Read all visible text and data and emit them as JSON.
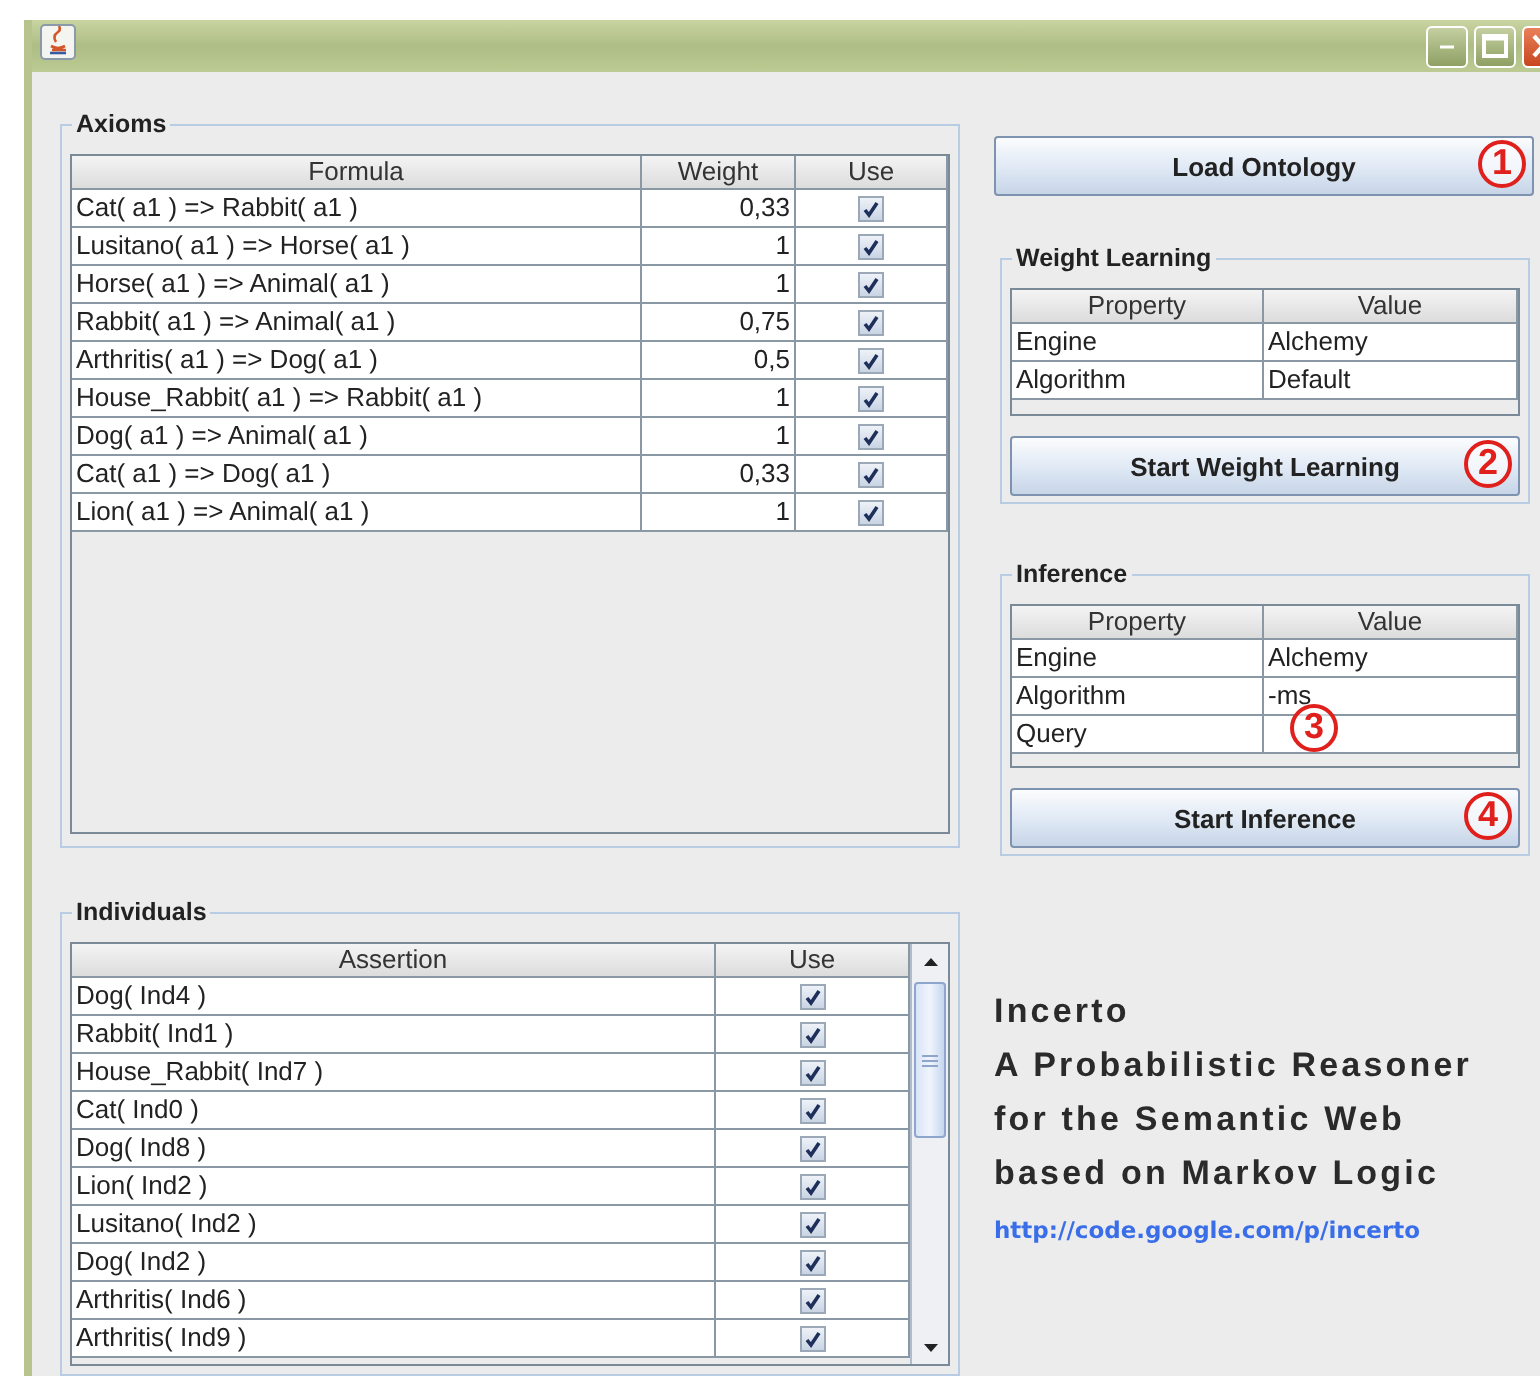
{
  "axioms": {
    "title": "Axioms",
    "columns": [
      "Formula",
      "Weight",
      "Use"
    ],
    "rows": [
      {
        "formula": "Cat( a1 ) => Rabbit( a1 )",
        "weight": "0,33",
        "use": true
      },
      {
        "formula": "Lusitano( a1 ) => Horse( a1 )",
        "weight": "1",
        "use": true
      },
      {
        "formula": "Horse( a1 ) => Animal( a1 )",
        "weight": "1",
        "use": true
      },
      {
        "formula": "Rabbit( a1 ) => Animal( a1 )",
        "weight": "0,75",
        "use": true
      },
      {
        "formula": "Arthritis( a1 ) => Dog( a1 )",
        "weight": "0,5",
        "use": true
      },
      {
        "formula": "House_Rabbit( a1 ) => Rabbit( a1 )",
        "weight": "1",
        "use": true
      },
      {
        "formula": "Dog( a1 ) => Animal( a1 )",
        "weight": "1",
        "use": true
      },
      {
        "formula": "Cat( a1 ) => Dog( a1 )",
        "weight": "0,33",
        "use": true
      },
      {
        "formula": "Lion( a1 ) => Animal( a1 )",
        "weight": "1",
        "use": true
      }
    ]
  },
  "individuals": {
    "title": "Individuals",
    "columns": [
      "Assertion",
      "Use"
    ],
    "rows": [
      {
        "assertion": "Dog( Ind4 )",
        "use": true
      },
      {
        "assertion": "Rabbit( Ind1 )",
        "use": true
      },
      {
        "assertion": "House_Rabbit( Ind7 )",
        "use": true
      },
      {
        "assertion": "Cat( Ind0 )",
        "use": true
      },
      {
        "assertion": "Dog( Ind8 )",
        "use": true
      },
      {
        "assertion": "Lion( Ind2 )",
        "use": true
      },
      {
        "assertion": "Lusitano( Ind2 )",
        "use": true
      },
      {
        "assertion": "Dog( Ind2 )",
        "use": true
      },
      {
        "assertion": "Arthritis( Ind6 )",
        "use": true
      },
      {
        "assertion": "Arthritis( Ind9 )",
        "use": true
      }
    ]
  },
  "load_button": {
    "label": "Load Ontology",
    "callout": "1"
  },
  "weight_learning": {
    "title": "Weight Learning",
    "columns": [
      "Property",
      "Value"
    ],
    "rows": [
      {
        "property": "Engine",
        "value": "Alchemy"
      },
      {
        "property": "Algorithm",
        "value": "Default"
      }
    ],
    "button": {
      "label": "Start Weight Learning",
      "callout": "2"
    }
  },
  "inference": {
    "title": "Inference",
    "columns": [
      "Property",
      "Value"
    ],
    "rows": [
      {
        "property": "Engine",
        "value": "Alchemy"
      },
      {
        "property": "Algorithm",
        "value": "-ms"
      },
      {
        "property": "Query"
      }
    ],
    "table_callout": "3",
    "button": {
      "label": "Start Inference",
      "callout": "4"
    }
  },
  "about": {
    "title": "Incerto",
    "lines": [
      "A Probabilistic Reasoner",
      "for the Semantic Web",
      "based on Markov Logic"
    ],
    "link": "http://code.google.com/p/incerto"
  }
}
